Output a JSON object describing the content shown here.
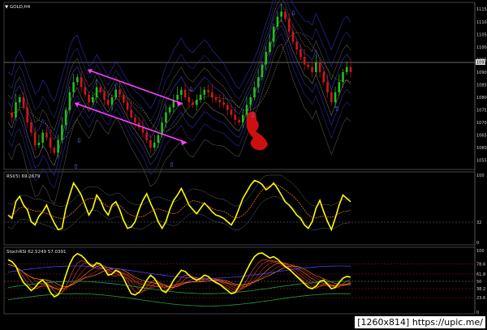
{
  "panes": {
    "main": {
      "title": "GOLD,H4",
      "price_labels": [
        "1115",
        "1110",
        "1105",
        "1100",
        "1095",
        "1090",
        "1085",
        "1080",
        "1075",
        "1070",
        "1065",
        "1060",
        "1055"
      ],
      "current_price_tag": "1093"
    },
    "rsi": {
      "title": "RSI(5) 69.2679",
      "levels": [
        "100",
        "32",
        "0"
      ]
    },
    "stoch": {
      "title": "StochRSI 62.5249 57.0391",
      "levels": [
        "100",
        "78.6",
        "61.8",
        "50",
        "38.2",
        "23.6",
        "0"
      ]
    }
  },
  "watermark": "[1260x814] https://upic.me/",
  "colors": {
    "background": "#000000",
    "bull_candle": "#22c022",
    "bear_candle": "#d01818",
    "rsi_line": "#ffff00",
    "trend_lines": "#ff40ff",
    "bands": "#4040d0",
    "arrows": "#7070ff",
    "horizontal_line": "#c8c8c8"
  },
  "chart_data": {
    "type": "line",
    "series": [
      {
        "values": [
          1074,
          1072,
          1078,
          1080,
          1076,
          1070,
          1066,
          1061,
          1062,
          1066,
          1064,
          1060,
          1058,
          1063,
          1069,
          1075,
          1082,
          1086,
          1088,
          1084,
          1081,
          1078,
          1080,
          1084,
          1082,
          1079,
          1077,
          1080,
          1083,
          1081,
          1078,
          1075,
          1072,
          1070,
          1068,
          1066,
          1063,
          1060,
          1062,
          1065,
          1070,
          1074,
          1076,
          1079,
          1081,
          1083,
          1080,
          1078,
          1077,
          1079,
          1081,
          1083,
          1082,
          1080,
          1079,
          1078,
          1077,
          1075,
          1073,
          1071,
          1070,
          1073,
          1077,
          1080,
          1084,
          1088,
          1093,
          1098,
          1102,
          1108,
          1112,
          1114,
          1111,
          1106,
          1102,
          1099,
          1096,
          1093,
          1092,
          1090,
          1094,
          1090,
          1086,
          1082,
          1078,
          1082,
          1086,
          1090,
          1092,
          1090
        ]
      },
      {
        "values": [
          40,
          35,
          60,
          68,
          55,
          48,
          30,
          25,
          38,
          45,
          55,
          40,
          28,
          18,
          20,
          50,
          70,
          88,
          80,
          70,
          55,
          40,
          50,
          70,
          62,
          48,
          40,
          55,
          60,
          48,
          32,
          20,
          22,
          30,
          48,
          62,
          72,
          58,
          45,
          30,
          20,
          30,
          48,
          62,
          70,
          80,
          68,
          55,
          48,
          42,
          50,
          58,
          52,
          45,
          40,
          38,
          35,
          30,
          25,
          35,
          50,
          65,
          75,
          85,
          92,
          90,
          86,
          78,
          82,
          88,
          80,
          70,
          60,
          55,
          48,
          40,
          35,
          25,
          20,
          30,
          50,
          62,
          45,
          30,
          18,
          35,
          55,
          70,
          65,
          60
        ]
      },
      {
        "values": [
          85,
          82,
          75,
          60,
          48,
          42,
          35,
          40,
          48,
          52,
          45,
          32,
          25,
          28,
          40,
          60,
          78,
          90,
          95,
          92,
          86,
          78,
          74,
          80,
          78,
          70,
          60,
          62,
          68,
          65,
          55,
          42,
          30,
          28,
          32,
          40,
          52,
          60,
          55,
          45,
          35,
          32,
          40,
          52,
          60,
          68,
          66,
          60,
          55,
          52,
          55,
          60,
          58,
          52,
          48,
          45,
          40,
          35,
          30,
          32,
          42,
          55,
          68,
          80,
          90,
          95,
          96,
          92,
          88,
          90,
          86,
          80,
          74,
          70,
          64,
          58,
          52,
          46,
          40,
          38,
          42,
          50,
          52,
          45,
          38,
          40,
          48,
          55,
          58,
          57
        ]
      }
    ]
  }
}
